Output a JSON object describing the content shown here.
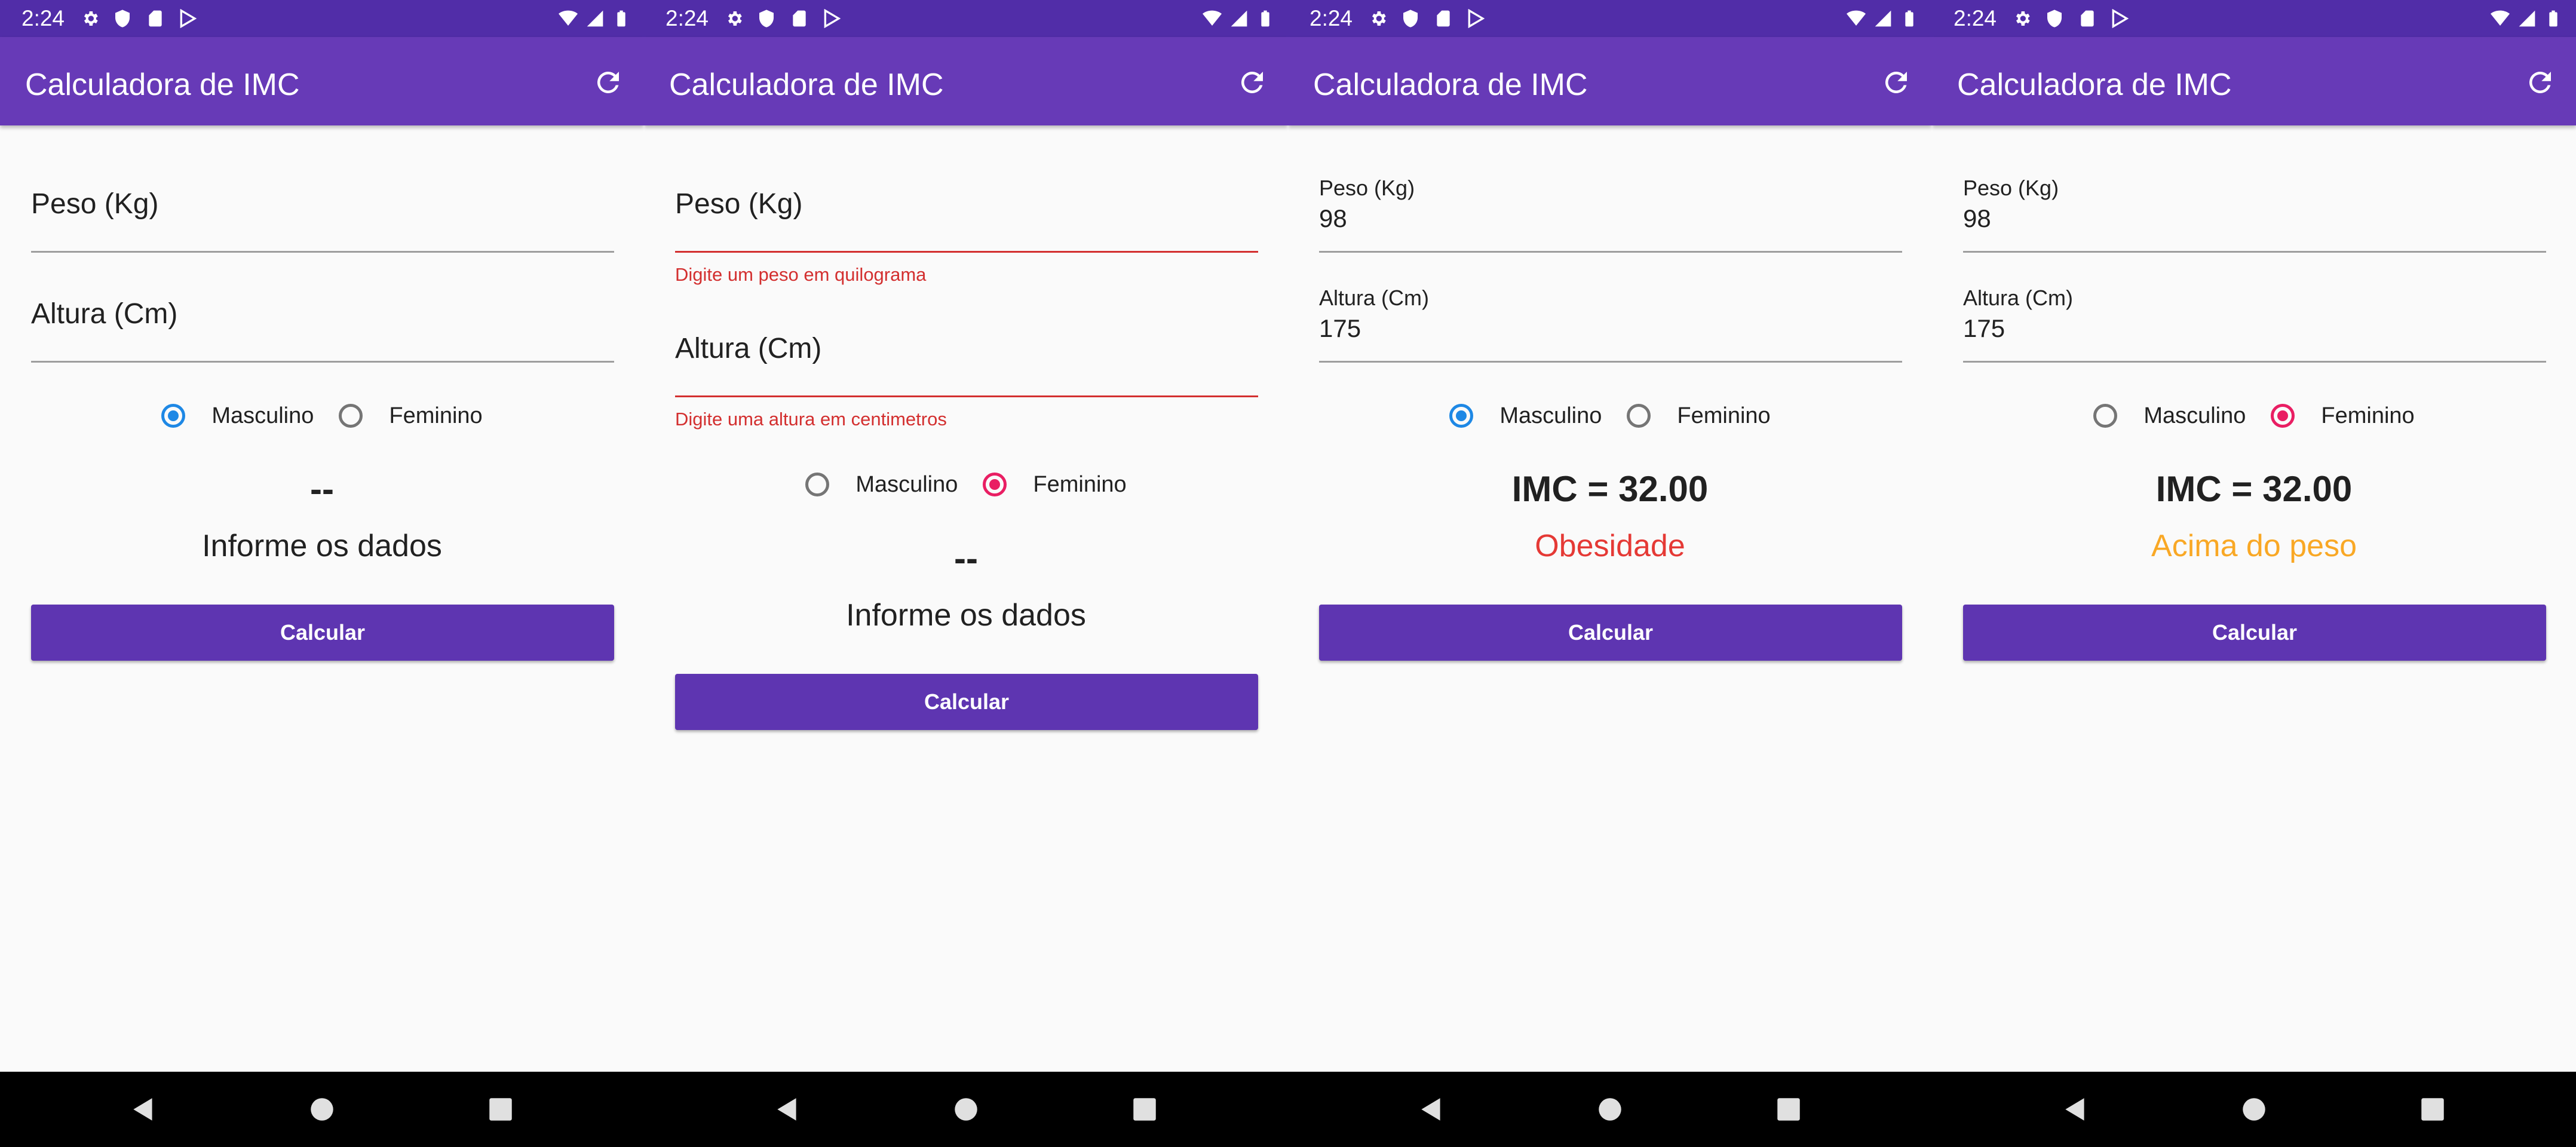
{
  "status_bar": {
    "time": "2:24"
  },
  "app_title": "Calculadora de IMC",
  "labels": {
    "weight": "Peso (Kg)",
    "height": "Altura (Cm)",
    "male": "Masculino",
    "female": "Feminino",
    "calculate": "Calcular"
  },
  "colors": {
    "app_bar": "#673ab7",
    "status_bar": "#512da8",
    "button": "#5e35b1",
    "radio_male": "#1e88e5",
    "radio_female": "#e91e63",
    "error": "#d32f2f",
    "obesity": "#e53935",
    "overweight": "#f9a825"
  },
  "screens": [
    {
      "weight_value": "",
      "height_value": "",
      "selected": "male",
      "result": "--",
      "message": "Informe os dados"
    },
    {
      "weight_value": "",
      "height_value": "",
      "weight_error": "Digite um peso em quilograma",
      "height_error": "Digite uma altura em centimetros",
      "selected": "female",
      "result": "--",
      "message": "Informe os dados"
    },
    {
      "weight_value": "98",
      "height_value": "175",
      "selected": "male",
      "result": "IMC = 32.00",
      "message": "Obesidade",
      "message_color": "#e53935"
    },
    {
      "weight_value": "98",
      "height_value": "175",
      "selected": "female",
      "result": "IMC = 32.00",
      "message": "Acima do peso",
      "message_color": "#f9a825"
    }
  ]
}
